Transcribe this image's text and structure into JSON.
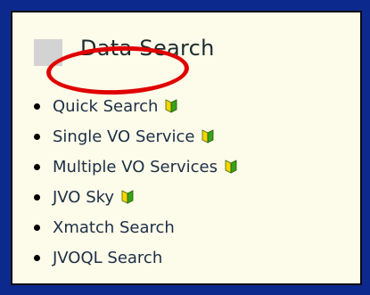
{
  "panel": {
    "title": "Data Search",
    "accent_colors": {
      "page_background": "#0c2a8e",
      "panel_background": "#fdfbe9",
      "link_text": "#1b2e46",
      "annotation_ring": "#e00000"
    }
  },
  "links": [
    {
      "label": "Quick Search",
      "icon": "beginner-leaf-icon"
    },
    {
      "label": "Single VO Service",
      "icon": "beginner-leaf-icon"
    },
    {
      "label": "Multiple VO Services",
      "icon": "beginner-leaf-icon"
    },
    {
      "label": "JVO Sky",
      "icon": "beginner-leaf-icon"
    },
    {
      "label": "Xmatch Search",
      "icon": null
    },
    {
      "label": "JVOQL Search",
      "icon": null
    }
  ]
}
